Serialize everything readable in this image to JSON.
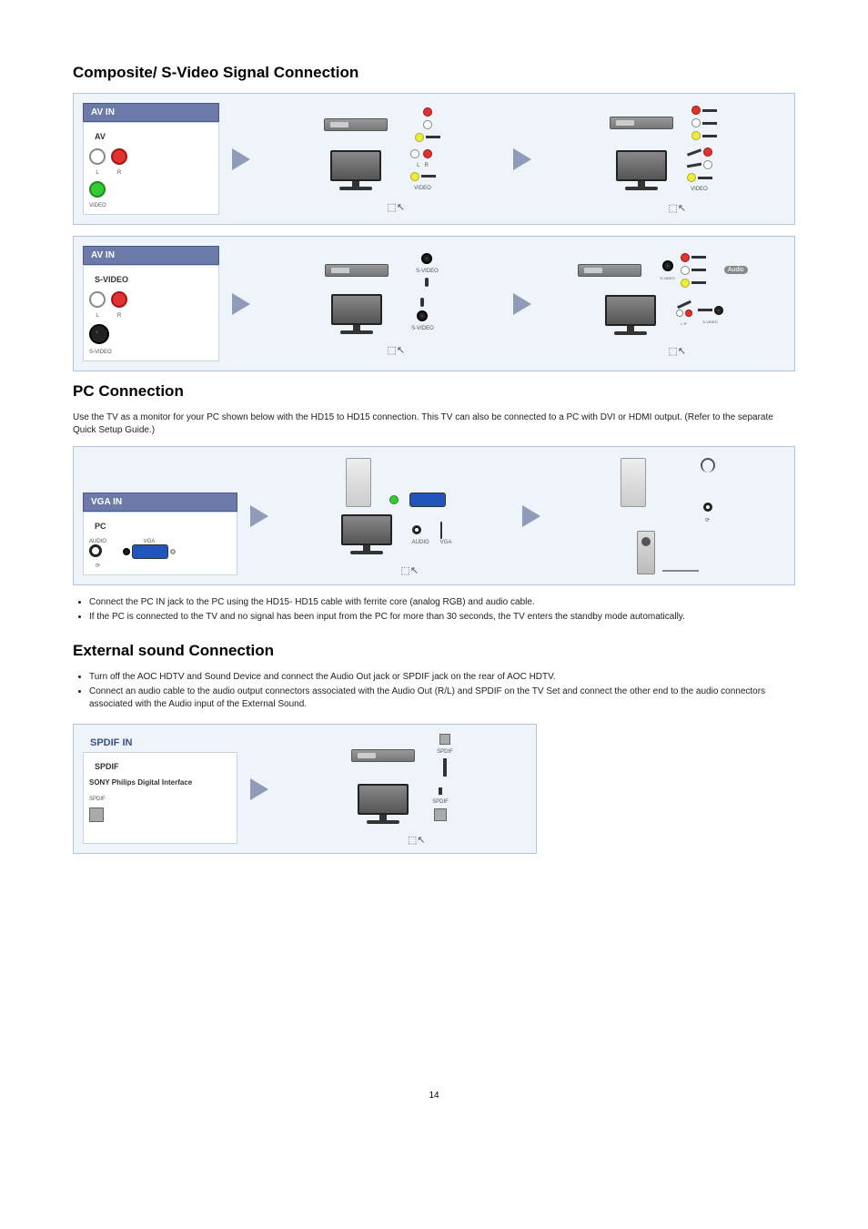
{
  "section1": {
    "heading": "Composite/ S-Video Signal Connection",
    "panel1": {
      "title": "AV IN",
      "subtitle": "AV",
      "l": "L",
      "r": "R",
      "video": "VIDEO"
    },
    "panel2": {
      "title": "AV IN",
      "subtitle": "S-VIDEO",
      "l": "L",
      "r": "R",
      "svideo": "S-VIDEO",
      "audio_tag": "Audio"
    }
  },
  "section2": {
    "heading": "PC Connection",
    "desc": "Use the TV as a monitor for your PC shown below with the HD15 to HD15 connection. This TV can also be connected to a PC with DVI or HDMI output. (Refer to the separate Quick Setup Guide.)",
    "panel": {
      "title": "VGA IN",
      "subtitle": "PC",
      "audio": "AUDIO",
      "vga": "VGA"
    },
    "bullets": [
      "Connect the PC IN jack to the PC using the HD15- HD15 cable with ferrite core (analog RGB) and audio cable.",
      "If the PC is connected to the TV and no signal has been input from the PC for more than 30 seconds, the TV enters the standby mode automatically."
    ]
  },
  "section3": {
    "heading": "External sound Connection",
    "bullets": [
      "Turn off the AOC HDTV and Sound Device and connect the Audio Out jack or SPDIF jack on the rear of AOC HDTV.",
      "Connect an audio cable to the audio output connectors associated with the Audio Out (R/L) and SPDIF on the TV Set and connect the other end to the audio connectors associated with the Audio input of the External Sound."
    ],
    "panel": {
      "title": "SPDIF IN",
      "subtitle": "SPDIF",
      "full": "SONY Philips Digital Interface",
      "port": "SPDIF"
    }
  },
  "page_number": "14"
}
